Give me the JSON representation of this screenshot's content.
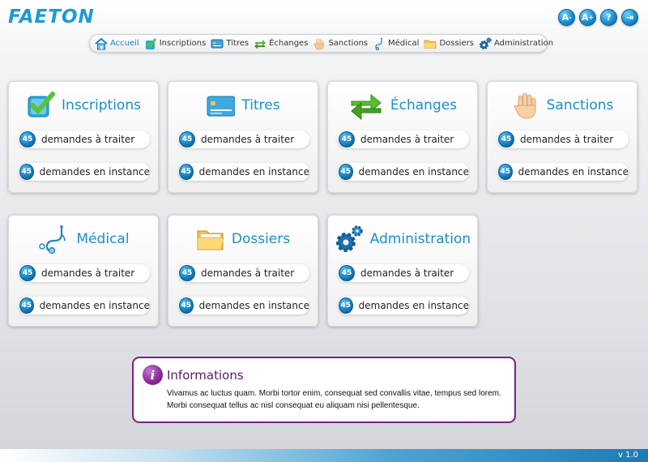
{
  "app": {
    "title": "FAETON",
    "version": "v 1.0"
  },
  "top_actions": [
    {
      "name": "font-decrease",
      "glyph": "A",
      "sub": "-"
    },
    {
      "name": "font-increase",
      "glyph": "A",
      "sub": "+"
    },
    {
      "name": "help",
      "glyph": "?",
      "sub": ""
    },
    {
      "name": "logout",
      "glyph": "⇥",
      "sub": ""
    }
  ],
  "nav": [
    {
      "label": "Accueil",
      "icon": "home-icon",
      "active": true
    },
    {
      "label": "Inscriptions",
      "icon": "check-icon"
    },
    {
      "label": "Titres",
      "icon": "card-icon"
    },
    {
      "label": "Échanges",
      "icon": "exchange-icon"
    },
    {
      "label": "Sanctions",
      "icon": "hand-icon"
    },
    {
      "label": "Médical",
      "icon": "stethoscope-icon"
    },
    {
      "label": "Dossiers",
      "icon": "folder-icon"
    },
    {
      "label": "Administration",
      "icon": "gear-icon"
    }
  ],
  "cards": [
    {
      "title": "Inscriptions",
      "icon": "check-icon",
      "stats": [
        {
          "count": "45",
          "label": "demandes à traiter"
        },
        {
          "count": "45",
          "label": "demandes en instance"
        }
      ]
    },
    {
      "title": "Titres",
      "icon": "card-icon",
      "stats": [
        {
          "count": "45",
          "label": "demandes à traiter"
        },
        {
          "count": "45",
          "label": "demandes en instance"
        }
      ]
    },
    {
      "title": "Échanges",
      "icon": "exchange-icon",
      "stats": [
        {
          "count": "45",
          "label": "demandes à traiter"
        },
        {
          "count": "45",
          "label": "demandes en instance"
        }
      ]
    },
    {
      "title": "Sanctions",
      "icon": "hand-icon",
      "stats": [
        {
          "count": "45",
          "label": "demandes à traiter"
        },
        {
          "count": "45",
          "label": "demandes en instance"
        }
      ]
    },
    {
      "title": "Médical",
      "icon": "stethoscope-icon",
      "stats": [
        {
          "count": "45",
          "label": "demandes à traiter"
        },
        {
          "count": "45",
          "label": "demandes en instance"
        }
      ]
    },
    {
      "title": "Dossiers",
      "icon": "folder-icon",
      "stats": [
        {
          "count": "45",
          "label": "demandes à traiter"
        },
        {
          "count": "45",
          "label": "demandes en instance"
        }
      ]
    },
    {
      "title": "Administration",
      "icon": "gear-icon",
      "stats": [
        {
          "count": "45",
          "label": "demandes à traiter"
        },
        {
          "count": "45",
          "label": "demandes en instance"
        }
      ]
    }
  ],
  "info": {
    "title": "Informations",
    "icon": "info-icon",
    "text": "Vivamus ac luctus quam. Morbi tortor enim, consequat sed convallis vitae, tempus sed lorem. Morbi consequat tellus ac nisl consequat eu aliquam nisi pellentesque."
  },
  "colors": {
    "accent": "#1a8fcc",
    "info_border": "#7e1f86",
    "badge": "#1479b9"
  }
}
